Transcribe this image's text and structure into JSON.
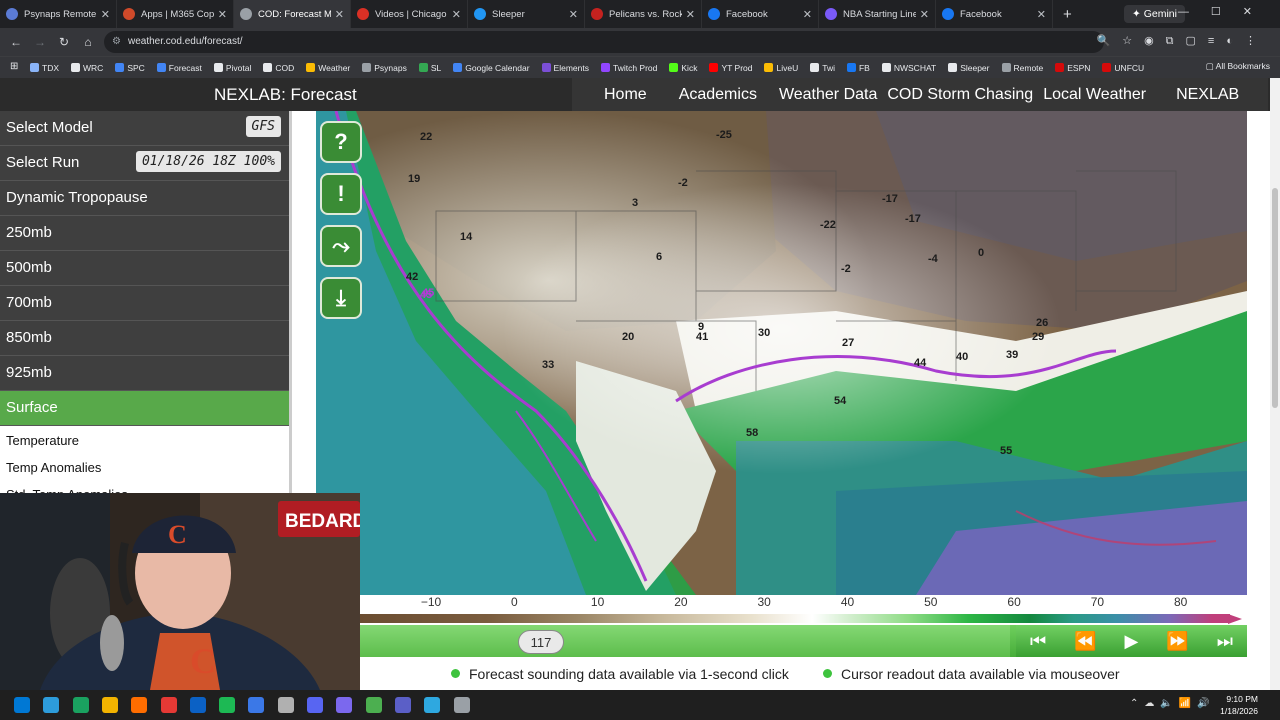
{
  "browser": {
    "tabs": [
      {
        "label": "Psynaps Remote Co",
        "color": "#5b7bd5",
        "active": false
      },
      {
        "label": "Apps | M365 Copilo",
        "color": "#d04a2a",
        "active": false
      },
      {
        "label": "COD: Forecast Mod",
        "color": "#9aa0a6",
        "active": true
      },
      {
        "label": "Videos | Chicago Be",
        "color": "#d93025",
        "active": false
      },
      {
        "label": "Sleeper",
        "color": "#2196f3",
        "active": false
      },
      {
        "label": "Pelicans vs. Rocket",
        "color": "#c5221f",
        "active": false
      },
      {
        "label": "Facebook",
        "color": "#1877f2",
        "active": false
      },
      {
        "label": "NBA Starting Lineu",
        "color": "#7a5af8",
        "active": false
      },
      {
        "label": "Facebook",
        "color": "#1877f2",
        "active": false
      }
    ],
    "gemini_label": "Gemini",
    "url": "weather.cod.edu/forecast/",
    "bookmarks": [
      {
        "label": "TDX",
        "color": "#8ab4f8"
      },
      {
        "label": "WRC",
        "color": "#e8eaed"
      },
      {
        "label": "SPC",
        "color": "#4285f4"
      },
      {
        "label": "Forecast",
        "color": "#4285f4"
      },
      {
        "label": "Pivotal",
        "color": "#e8eaed"
      },
      {
        "label": "COD",
        "color": "#e8eaed"
      },
      {
        "label": "Weather",
        "color": "#fbbc04"
      },
      {
        "label": "Psynaps",
        "color": "#9aa0a6"
      },
      {
        "label": "SL",
        "color": "#34a853"
      },
      {
        "label": "Google Calendar",
        "color": "#4285f4"
      },
      {
        "label": "Elements",
        "color": "#7b4fd6"
      },
      {
        "label": "Twitch Prod",
        "color": "#9146ff"
      },
      {
        "label": "Kick",
        "color": "#53fc18"
      },
      {
        "label": "YT Prod",
        "color": "#ff0000"
      },
      {
        "label": "LiveU",
        "color": "#fbbc04"
      },
      {
        "label": "Twi",
        "color": "#e8eaed"
      },
      {
        "label": "FB",
        "color": "#1877f2"
      },
      {
        "label": "NWSCHAT",
        "color": "#e8eaed"
      },
      {
        "label": "Sleeper",
        "color": "#e8eaed"
      },
      {
        "label": "Remote",
        "color": "#9aa0a6"
      },
      {
        "label": "ESPN",
        "color": "#d50a0a"
      },
      {
        "label": "UNFCU",
        "color": "#d50a0a"
      }
    ],
    "all_bookmarks": "All Bookmarks"
  },
  "site": {
    "brand": "NEXLAB: Forecast",
    "nav": [
      "Home",
      "Academics",
      "Weather Data",
      "COD Storm Chasing",
      "Local Weather",
      "NEXLAB"
    ]
  },
  "sidebar": {
    "select_model_label": "Select Model",
    "select_model_value": "GFS",
    "select_run_label": "Select Run",
    "select_run_value": "01/18/26 18Z 100%",
    "levels": [
      "Dynamic Tropopause",
      "250mb",
      "500mb",
      "700mb",
      "850mb",
      "925mb",
      "Surface"
    ],
    "active_level": "Surface",
    "surface_items": [
      "Temperature",
      "Temp Anomalies",
      "Std. Temp Anomalies"
    ]
  },
  "map": {
    "labels": [
      "22",
      "-25",
      "19",
      "-2",
      "3",
      "-17",
      "-22",
      "-17",
      "14",
      "6",
      "-4",
      "0",
      "-2",
      "42",
      "45",
      "9",
      "30",
      "41",
      "20",
      "27",
      "26",
      "29",
      "33",
      "44",
      "40",
      "39",
      "54",
      "58",
      "55",
      "45"
    ]
  },
  "colorbar": {
    "ticks": [
      "−10",
      "0",
      "10",
      "20",
      "30",
      "40",
      "50",
      "60",
      "70",
      "80"
    ]
  },
  "timeline": {
    "frame": "117"
  },
  "notes": {
    "sounding": "Forecast sounding data available via 1-second click",
    "readout": "Cursor readout data available via mouseover"
  },
  "webcam": {
    "sign_text": "BEDARD"
  },
  "taskbar": {
    "time": "9:10 PM",
    "date": "1/18/2026"
  }
}
